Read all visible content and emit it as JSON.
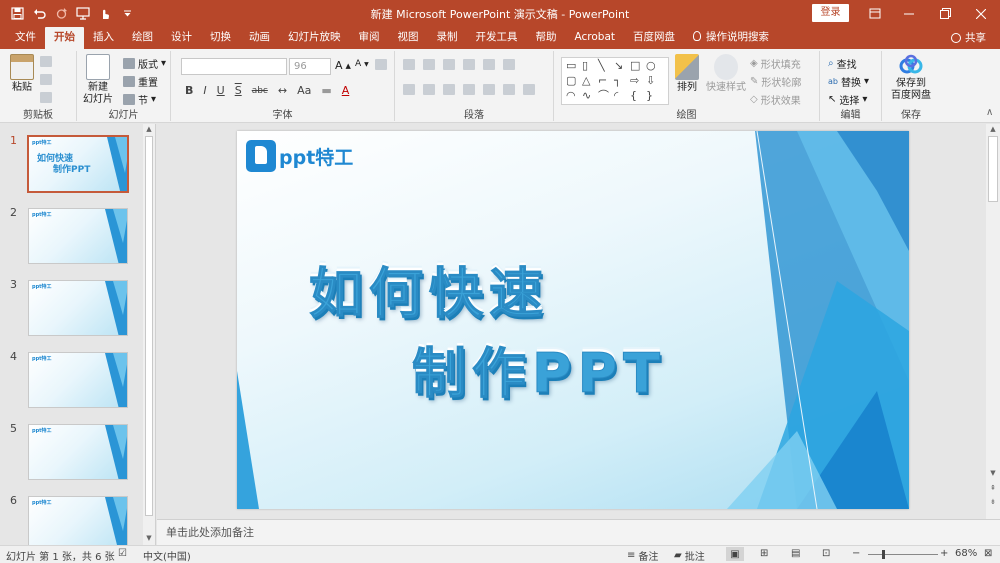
{
  "titlebar": {
    "title": "新建 Microsoft PowerPoint 演示文稿 - PowerPoint",
    "login": "登录",
    "qat_icons": [
      "save-icon",
      "undo-icon",
      "redo-icon",
      "present-icon",
      "touch-icon",
      "customize-icon"
    ]
  },
  "tabs": [
    "文件",
    "开始",
    "插入",
    "绘图",
    "设计",
    "切换",
    "动画",
    "幻灯片放映",
    "审阅",
    "视图",
    "录制",
    "开发工具",
    "帮助",
    "Acrobat",
    "百度网盘",
    "操作说明搜索"
  ],
  "active_tab": "开始",
  "share": "共享",
  "ribbon": {
    "clipboard": {
      "label": "剪贴板",
      "paste": "粘贴"
    },
    "slides": {
      "label": "幻灯片",
      "new_slide_line1": "新建",
      "new_slide_line2": "幻灯片",
      "layout": "版式",
      "reset": "重置",
      "section": "节"
    },
    "font": {
      "label": "字体",
      "size": "96",
      "bold": "B",
      "italic": "I",
      "underline": "U",
      "strike": "S",
      "spacing": "abc",
      "case": "Aa",
      "grow": "A",
      "shrink": "A"
    },
    "paragraph": {
      "label": "段落"
    },
    "drawing": {
      "label": "绘图",
      "arrange": "排列",
      "quick_styles": "快速样式",
      "fill": "形状填充",
      "outline": "形状轮廓",
      "effects": "形状效果"
    },
    "editing": {
      "label": "编辑",
      "find": "查找",
      "replace": "替换",
      "select": "选择"
    },
    "save": {
      "label": "保存",
      "line1": "保存到",
      "line2": "百度网盘"
    }
  },
  "slides_panel": {
    "numbers": [
      "1",
      "2",
      "3",
      "4",
      "5",
      "6"
    ],
    "selected": 1,
    "thumb1_title_line1": "如何快速",
    "thumb1_title_line2": "制作PPT"
  },
  "slide": {
    "logo_text": "ppt特工",
    "title_line1": "如何快速",
    "title_line2": "制作PPT",
    "colors": {
      "primary": "#3aa2d8",
      "dark": "#1f88d2",
      "accent": "#b7472a"
    }
  },
  "notes_placeholder": "单击此处添加备注",
  "statusbar": {
    "slide_info": "幻灯片 第 1 张，共 6 张",
    "language": "中文(中国)",
    "notes": "备注",
    "comments": "批注",
    "zoom": "68%",
    "minus": "−",
    "plus": "+"
  }
}
